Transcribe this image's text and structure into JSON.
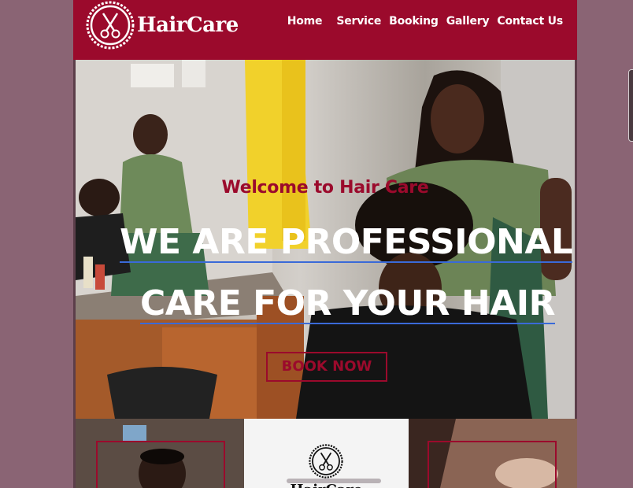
{
  "header": {
    "brand": "HairCare",
    "nav": [
      "Home",
      "Service",
      "Booking",
      "Gallery",
      "Contact Us"
    ]
  },
  "hero": {
    "subtitle": "Welcome to Hair Care",
    "title_line1": "WE ARE PROFESSIONAL",
    "title_line2": "CARE FOR YOUR HAIR",
    "cta": "BOOK NOW"
  },
  "cards": {
    "brand": "HairCare"
  },
  "colors": {
    "brand": "#9b0a2c",
    "page_bg": "#8a6474",
    "underline": "#3a6ad8"
  },
  "icons": [
    "scissors-logo-icon"
  ]
}
